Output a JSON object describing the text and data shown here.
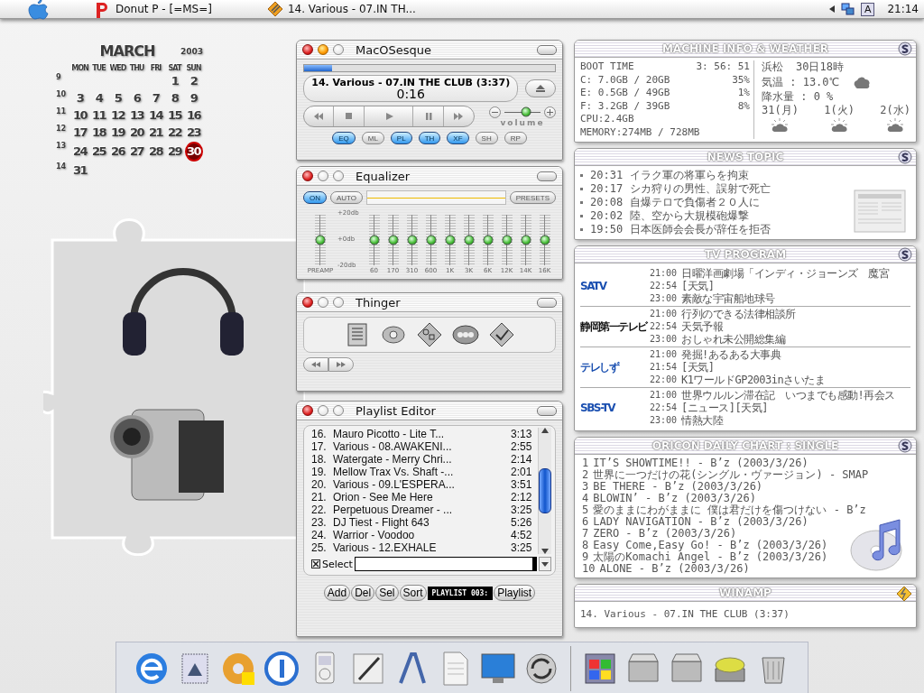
{
  "menu_bar": {
    "apps": [
      {
        "kind": "browser",
        "title": "Donut P - [=MS=]"
      },
      {
        "kind": "player",
        "title": "14. Various - 07.IN TH..."
      }
    ],
    "input_mode": "A",
    "clock": "21:14"
  },
  "calendar": {
    "month": "MARCH",
    "year": "2003",
    "weekdays": [
      "MON",
      "TUE",
      "WED",
      "THU",
      "FRI",
      "SAT",
      "SUN"
    ],
    "weeks": [
      {
        "number": "9",
        "days": [
          {
            "day": "1",
            "selected": false
          },
          {
            "day": "2",
            "selected": false
          }
        ]
      },
      {
        "number": "10",
        "days": [
          {
            "day": "3",
            "selected": false
          },
          {
            "day": "4",
            "selected": false
          },
          {
            "day": "5",
            "selected": false
          },
          {
            "day": "6",
            "selected": false
          },
          {
            "day": "7",
            "selected": false
          },
          {
            "day": "8",
            "selected": false
          },
          {
            "day": "9",
            "selected": false
          }
        ]
      },
      {
        "number": "11",
        "days": [
          {
            "day": "10",
            "selected": false
          },
          {
            "day": "11",
            "selected": false
          },
          {
            "day": "12",
            "selected": false
          },
          {
            "day": "13",
            "selected": false
          },
          {
            "day": "14",
            "selected": false
          },
          {
            "day": "15",
            "selected": false
          },
          {
            "day": "16",
            "selected": false
          }
        ]
      },
      {
        "number": "12",
        "days": [
          {
            "day": "17",
            "selected": false
          },
          {
            "day": "18",
            "selected": false
          },
          {
            "day": "19",
            "selected": false
          },
          {
            "day": "20",
            "selected": false
          },
          {
            "day": "21",
            "selected": false
          },
          {
            "day": "22",
            "selected": false
          },
          {
            "day": "23",
            "selected": false
          }
        ]
      },
      {
        "number": "13",
        "days": [
          {
            "day": "24",
            "selected": false
          },
          {
            "day": "25",
            "selected": false
          },
          {
            "day": "26",
            "selected": false
          },
          {
            "day": "27",
            "selected": false
          },
          {
            "day": "28",
            "selected": false
          },
          {
            "day": "29",
            "selected": false
          },
          {
            "day": "30",
            "selected": true
          }
        ]
      },
      {
        "number": "14",
        "days": [
          {
            "day": "31",
            "selected": false
          }
        ]
      }
    ]
  },
  "windows": [
    {
      "kind": "player",
      "title": "MacOSesque",
      "minimize_enabled": true,
      "progress": {
        "level": 0.11
      },
      "track": "14. Various - 07.IN THE CLUB (3:37)",
      "time": "0:16",
      "volume": {
        "label": "volume",
        "level": 0.6
      },
      "toggles": [
        {
          "label": "EQ",
          "on": true
        },
        {
          "label": "ML",
          "on": false
        },
        {
          "label": "PL",
          "on": true
        },
        {
          "label": "TH",
          "on": true
        },
        {
          "label": "XF",
          "on": true
        },
        {
          "label": "SH",
          "on": false
        },
        {
          "label": "RP",
          "on": false
        }
      ]
    },
    {
      "kind": "equalizer",
      "title": "Equalizer",
      "minimize_enabled": false,
      "toggles": [
        {
          "label": "ON",
          "on": true
        },
        {
          "label": "AUTO",
          "on": false
        }
      ],
      "presets": "PRESETS",
      "scale": [
        "+20db",
        "+0db",
        "-20db"
      ],
      "preamp": {
        "label": "PREAMP",
        "level": 0.5
      },
      "bands": [
        {
          "label": "60",
          "level": 0.5
        },
        {
          "label": "170",
          "level": 0.5
        },
        {
          "label": "310",
          "level": 0.5
        },
        {
          "label": "600",
          "level": 0.5
        },
        {
          "label": "1K",
          "level": 0.5
        },
        {
          "label": "3K",
          "level": 0.5
        },
        {
          "label": "6K",
          "level": 0.5
        },
        {
          "label": "12K",
          "level": 0.5
        },
        {
          "label": "14K",
          "level": 0.5
        },
        {
          "label": "16K",
          "level": 0.5
        }
      ]
    },
    {
      "kind": "thinger",
      "title": "Thinger",
      "minimize_enabled": false
    },
    {
      "kind": "playlist",
      "title": "Playlist Editor",
      "minimize_enabled": false,
      "rows": [
        {
          "number": "16.",
          "title": "Mauro Picotto - Lite T...",
          "time": "3:13"
        },
        {
          "number": "17.",
          "title": "Various - 08.AWAKENI...",
          "time": "2:55"
        },
        {
          "number": "18.",
          "title": "Watergate - Merry Chri...",
          "time": "2:14"
        },
        {
          "number": "19.",
          "title": "Mellow Trax Vs. Shaft -...",
          "time": "2:01"
        },
        {
          "number": "20.",
          "title": "Various - 09.L'ESPERA...",
          "time": "3:51"
        },
        {
          "number": "21.",
          "title": "Orion - See Me Here",
          "time": "2:12"
        },
        {
          "number": "22.",
          "title": "Perpetuous Dreamer - ...",
          "time": "3:25"
        },
        {
          "number": "23.",
          "title": "DJ Tiest - Flight 643",
          "time": "5:26"
        },
        {
          "number": "24.",
          "title": "Warrior - Voodoo",
          "time": "4:52"
        },
        {
          "number": "25.",
          "title": "Various - 12.EXHALE",
          "time": "3:25"
        }
      ],
      "select_label": "Select",
      "buttons": [
        "Add",
        "Del",
        "Sel",
        "Sort"
      ],
      "display": "PLAYLIST 003:",
      "menu_button": "Playlist"
    }
  ],
  "panels": [
    {
      "kind": "machine",
      "title": "MACHINE INFO & WEATHER",
      "boot": {
        "label": "BOOT TIME",
        "value": "3: 56: 51"
      },
      "drives": [
        {
          "label": "C: 7.0GB / 20GB",
          "percent": "35%"
        },
        {
          "label": "E: 0.5GB / 49GB",
          "percent": "1%"
        },
        {
          "label": "F: 3.2GB / 39GB",
          "percent": "8%"
        }
      ],
      "cpu": "CPU:2.4GB",
      "memory": "MEMORY:274MB / 728MB",
      "weather": {
        "city": "浜松",
        "time": "30日18時",
        "temperature": "気温 : 13.0℃",
        "rain": "降水量 : 0 %",
        "forecast": [
          "31(月)",
          "1(火)",
          "2(水)"
        ]
      }
    },
    {
      "kind": "news",
      "title": "NEWS TOPIC",
      "items": [
        {
          "time": "20:31",
          "text": "イラク軍の将軍らを拘束"
        },
        {
          "time": "20:17",
          "text": "シカ狩りの男性、誤射で死亡"
        },
        {
          "time": "20:08",
          "text": "自爆テロで負傷者２０人に"
        },
        {
          "time": "20:02",
          "text": "陸、空から大規模砲爆撃"
        },
        {
          "time": "19:50",
          "text": "日本医師会会長が辞任を拒否"
        }
      ]
    },
    {
      "kind": "tv",
      "title": "TV PROGRAM",
      "channels": [
        {
          "logo": "SATV",
          "programs": [
            {
              "time": "21:00",
              "title": "日曜洋画劇場「インディ・ジョーンズ　魔宮"
            },
            {
              "time": "22:54",
              "title": "[天気]"
            },
            {
              "time": "23:00",
              "title": "素敵な宇宙船地球号"
            }
          ]
        },
        {
          "logo": "静岡第一テレビ",
          "programs": [
            {
              "time": "21:00",
              "title": "行列のできる法律相談所"
            },
            {
              "time": "22:54",
              "title": "天気予報"
            },
            {
              "time": "23:00",
              "title": "おしゃれ未公開総集編"
            }
          ]
        },
        {
          "logo": "テレしず",
          "programs": [
            {
              "time": "21:00",
              "title": "発掘!あるある大事典"
            },
            {
              "time": "21:54",
              "title": "[天気]"
            },
            {
              "time": "22:00",
              "title": "K1ワールドGP2003inさいたま"
            }
          ]
        },
        {
          "logo": "SBS-TV",
          "programs": [
            {
              "time": "21:00",
              "title": "世界ウルルン滞在記　いつまでも感動!再会ス"
            },
            {
              "time": "22:54",
              "title": "[ニュース][天気]"
            },
            {
              "time": "23:00",
              "title": "情熱大陸"
            }
          ]
        }
      ]
    },
    {
      "kind": "chart",
      "title": "ORICON DAILY CHART : SINGLE",
      "items": [
        {
          "rank": "1",
          "text": "IT’S SHOWTIME!! - B’z (2003/3/26)"
        },
        {
          "rank": "2",
          "text": "世界に一つだけの花(シングル・ヴァージョン) - SMAP"
        },
        {
          "rank": "3",
          "text": "BE THERE - B’z (2003/3/26)"
        },
        {
          "rank": "4",
          "text": "BLOWIN’ - B’z (2003/3/26)"
        },
        {
          "rank": "5",
          "text": "愛のままにわがままに 僕は君だけを傷つけない - B’z"
        },
        {
          "rank": "6",
          "text": "LADY NAVIGATION - B’z (2003/3/26)"
        },
        {
          "rank": "7",
          "text": "ZERO - B’z (2003/3/26)"
        },
        {
          "rank": "8",
          "text": "Easy Come,Easy Go! - B’z (2003/3/26)"
        },
        {
          "rank": "9",
          "text": "太陽のKomachi Angel - B’z (2003/3/26)"
        },
        {
          "rank": "10",
          "text": "ALONE - B’z (2003/3/26)"
        }
      ]
    },
    {
      "kind": "winamp",
      "title": "WINAMP",
      "text": "14. Various - 07.IN THE CLUB (3:37)"
    }
  ]
}
